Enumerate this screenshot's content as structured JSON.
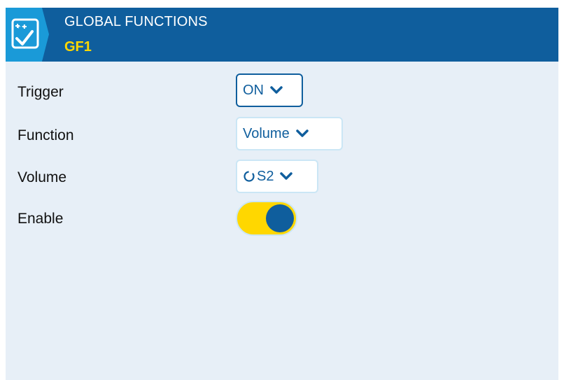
{
  "header": {
    "title": "GLOBAL FUNCTIONS",
    "subtitle": "GF1",
    "icon": "checklist-icon",
    "bg_color": "#0f5e9d",
    "subtitle_color": "#ffd700"
  },
  "rows": [
    {
      "label": "Trigger",
      "value": "ON",
      "control": "dropdown"
    },
    {
      "label": "Function",
      "value": "Volume",
      "control": "dropdown"
    },
    {
      "label": "Volume",
      "value": "S2",
      "value_icon": "pot-icon",
      "control": "dropdown"
    },
    {
      "label": "Enable",
      "value": true,
      "control": "toggle"
    }
  ],
  "colors": {
    "background": "#e7eff7",
    "accent": "#0f5e9d",
    "toggle_on": "#ffd700"
  }
}
